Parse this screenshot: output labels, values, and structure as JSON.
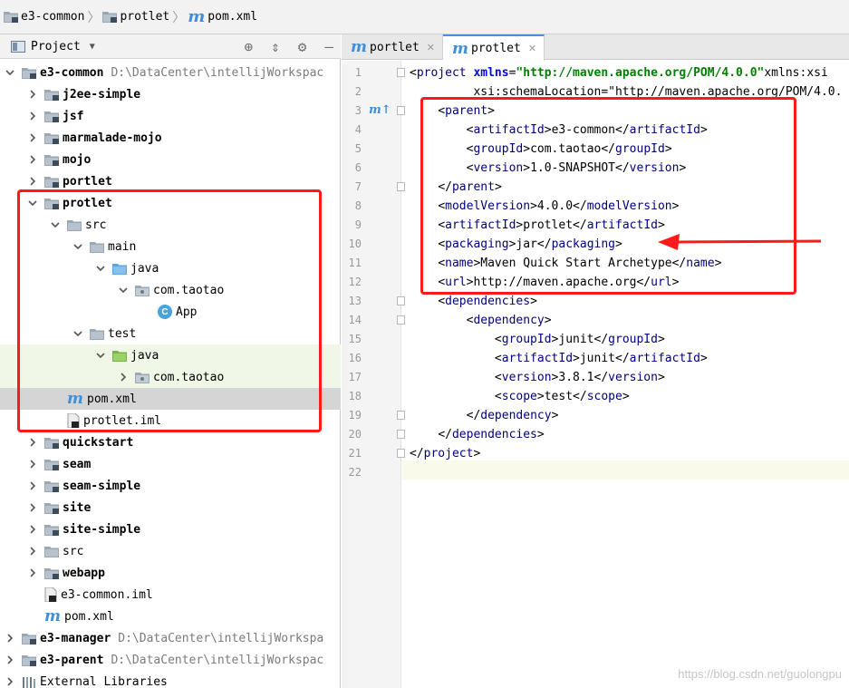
{
  "breadcrumb": [
    {
      "label": "e3-common",
      "icon": "module-folder-icon"
    },
    {
      "label": "protlet",
      "icon": "module-folder-icon"
    },
    {
      "label": "pom.xml",
      "icon": "maven-icon"
    }
  ],
  "project_panel": {
    "title": "Project",
    "toolbar_icons": [
      "locate-icon",
      "collapse-icon",
      "settings-icon",
      "hide-icon"
    ]
  },
  "tree": [
    {
      "label": "e3-common",
      "path": "D:\\DataCenter\\intellijWorkspac",
      "icon": "module",
      "expanded": true,
      "bold": true
    },
    {
      "label": "j2ee-simple",
      "icon": "module",
      "expanded": false,
      "bold": true
    },
    {
      "label": "jsf",
      "icon": "module",
      "expanded": false,
      "bold": true
    },
    {
      "label": "marmalade-mojo",
      "icon": "module",
      "expanded": false,
      "bold": true
    },
    {
      "label": "mojo",
      "icon": "module",
      "expanded": false,
      "bold": true
    },
    {
      "label": "portlet",
      "icon": "module",
      "expanded": false,
      "bold": true
    },
    {
      "label": "protlet",
      "icon": "module",
      "expanded": true,
      "bold": true
    },
    {
      "label": "src",
      "icon": "folder",
      "expanded": true
    },
    {
      "label": "main",
      "icon": "folder",
      "expanded": true
    },
    {
      "label": "java",
      "icon": "source-folder",
      "expanded": true
    },
    {
      "label": "com.taotao",
      "icon": "package",
      "expanded": true
    },
    {
      "label": "App",
      "icon": "class"
    },
    {
      "label": "test",
      "icon": "folder",
      "expanded": true
    },
    {
      "label": "java",
      "icon": "test-folder",
      "expanded": true
    },
    {
      "label": "com.taotao",
      "icon": "package",
      "expanded": false
    },
    {
      "label": "pom.xml",
      "icon": "maven",
      "selected": true
    },
    {
      "label": "protlet.iml",
      "icon": "iml"
    },
    {
      "label": "quickstart",
      "icon": "module",
      "expanded": false,
      "bold": true
    },
    {
      "label": "seam",
      "icon": "module",
      "expanded": false,
      "bold": true
    },
    {
      "label": "seam-simple",
      "icon": "module",
      "expanded": false,
      "bold": true
    },
    {
      "label": "site",
      "icon": "module",
      "expanded": false,
      "bold": true
    },
    {
      "label": "site-simple",
      "icon": "module",
      "expanded": false,
      "bold": true
    },
    {
      "label": "src",
      "icon": "folder",
      "expanded": false
    },
    {
      "label": "webapp",
      "icon": "module",
      "expanded": false,
      "bold": true
    },
    {
      "label": "e3-common.iml",
      "icon": "iml"
    },
    {
      "label": "pom.xml",
      "icon": "maven"
    },
    {
      "label": "e3-manager",
      "path": "D:\\DataCenter\\intellijWorkspa",
      "icon": "module",
      "expanded": false,
      "bold": true
    },
    {
      "label": "e3-parent",
      "path": "D:\\DataCenter\\intellijWorkspac",
      "icon": "module",
      "expanded": false,
      "bold": true
    },
    {
      "label": "External Libraries",
      "icon": "library",
      "expanded": false
    }
  ],
  "tabs": [
    {
      "label": "portlet",
      "active": false
    },
    {
      "label": "protlet",
      "active": true
    }
  ],
  "code_lines": [
    {
      "n": "1",
      "text": "<project xmlns=\"http://maven.apache.org/POM/4.0.0\" xmlns:xsi"
    },
    {
      "n": "2",
      "text": "         xsi:schemaLocation=\"http://maven.apache.org/POM/4.0."
    },
    {
      "n": "3",
      "text": "    <parent>"
    },
    {
      "n": "4",
      "text": "        <artifactId>e3-common</artifactId>"
    },
    {
      "n": "5",
      "text": "        <groupId>com.taotao</groupId>"
    },
    {
      "n": "6",
      "text": "        <version>1.0-SNAPSHOT</version>"
    },
    {
      "n": "7",
      "text": "    </parent>"
    },
    {
      "n": "8",
      "text": "    <modelVersion>4.0.0</modelVersion>"
    },
    {
      "n": "9",
      "text": "    <artifactId>protlet</artifactId>"
    },
    {
      "n": "10",
      "text": "    <packaging>jar</packaging>"
    },
    {
      "n": "11",
      "text": "    <name>Maven Quick Start Archetype</name>"
    },
    {
      "n": "12",
      "text": "    <url>http://maven.apache.org</url>"
    },
    {
      "n": "13",
      "text": "    <dependencies>"
    },
    {
      "n": "14",
      "text": "        <dependency>"
    },
    {
      "n": "15",
      "text": "            <groupId>junit</groupId>"
    },
    {
      "n": "16",
      "text": "            <artifactId>junit</artifactId>"
    },
    {
      "n": "17",
      "text": "            <version>3.8.1</version>"
    },
    {
      "n": "18",
      "text": "            <scope>test</scope>"
    },
    {
      "n": "19",
      "text": "        </dependency>"
    },
    {
      "n": "20",
      "text": "    </dependencies>"
    },
    {
      "n": "21",
      "text": "</project>"
    },
    {
      "n": "22",
      "text": ""
    }
  ],
  "watermark": "https://blog.csdn.net/guolongpu",
  "colors": {
    "annotation_red": "#ff1a1a",
    "maven_blue": "#3f8fda",
    "tag_blue": "#000080",
    "value_green": "#008000"
  }
}
